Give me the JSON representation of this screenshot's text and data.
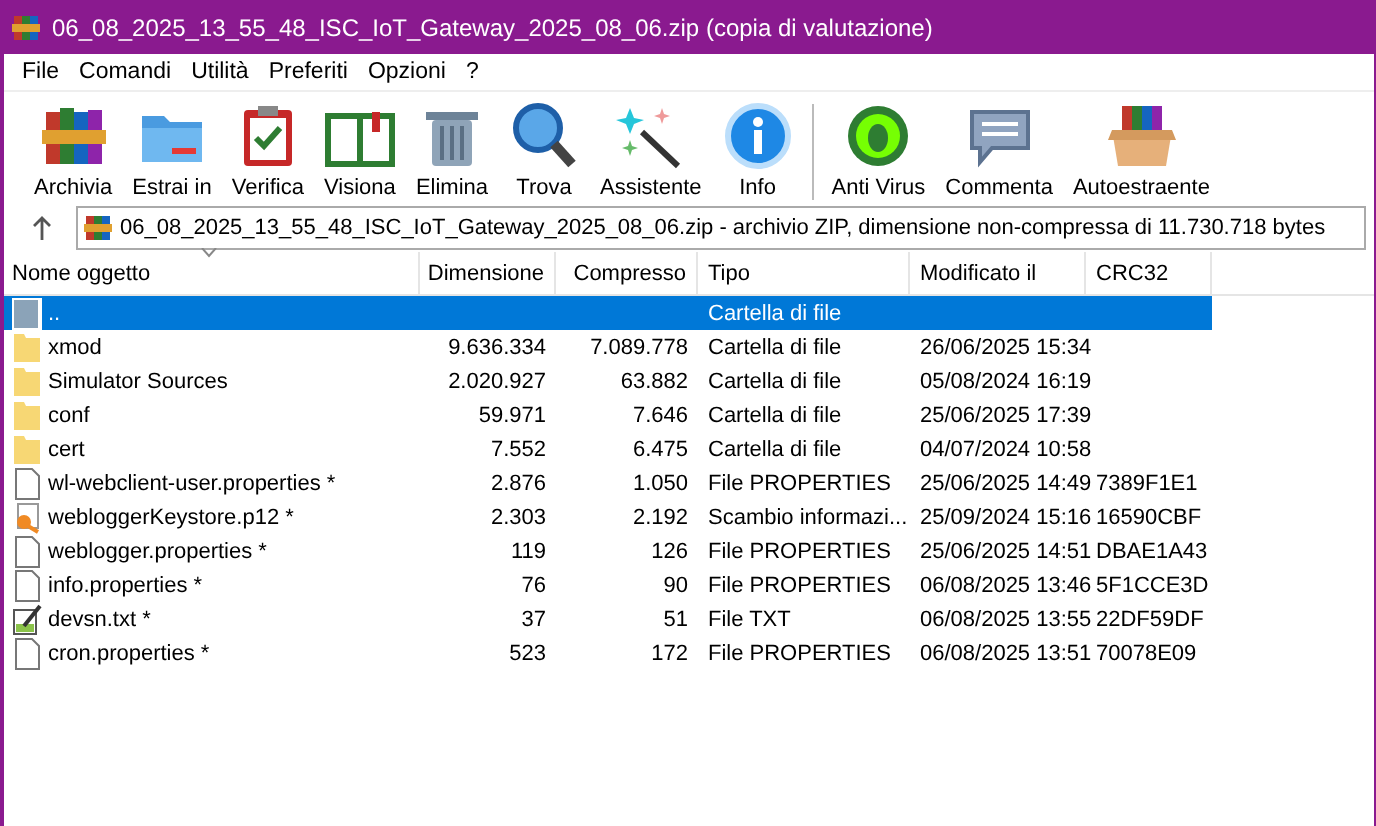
{
  "window": {
    "title": "06_08_2025_13_55_48_ISC_IoT_Gateway_2025_08_06.zip (copia di valutazione)"
  },
  "menu": [
    "File",
    "Comandi",
    "Utilità",
    "Preferiti",
    "Opzioni",
    "?"
  ],
  "toolbar_groups": [
    [
      {
        "label": "Archivia",
        "kind": "archive"
      },
      {
        "label": "Estrai in",
        "kind": "extract"
      },
      {
        "label": "Verifica",
        "kind": "test"
      },
      {
        "label": "Visiona",
        "kind": "view"
      },
      {
        "label": "Elimina",
        "kind": "delete"
      },
      {
        "label": "Trova",
        "kind": "find"
      },
      {
        "label": "Assistente",
        "kind": "wizard"
      },
      {
        "label": "Info",
        "kind": "info"
      }
    ],
    [
      {
        "label": "Anti Virus",
        "kind": "virus"
      },
      {
        "label": "Commenta",
        "kind": "comment"
      },
      {
        "label": "Autoestraente",
        "kind": "sfx"
      }
    ]
  ],
  "address": {
    "text": "06_08_2025_13_55_48_ISC_IoT_Gateway_2025_08_06.zip - archivio ZIP, dimensione non-compressa di 11.730.718 bytes"
  },
  "table": {
    "columns": [
      "Nome oggetto",
      "Dimensione",
      "Compresso",
      "Tipo",
      "Modificato il",
      "CRC32"
    ],
    "rows": [
      {
        "kind": "up",
        "name": "..",
        "type": "Cartella di file",
        "selected": true
      },
      {
        "kind": "folder",
        "name": "xmod",
        "size": "9.636.334",
        "packed": "7.089.778",
        "type": "Cartella di file",
        "modified": "26/06/2025 15:34",
        "selected": false
      },
      {
        "kind": "folder",
        "name": "Simulator Sources",
        "size": "2.020.927",
        "packed": "63.882",
        "type": "Cartella di file",
        "modified": "05/08/2024 16:19",
        "selected": false
      },
      {
        "kind": "folder",
        "name": "conf",
        "size": "59.971",
        "packed": "7.646",
        "type": "Cartella di file",
        "modified": "25/06/2025 17:39",
        "selected": false
      },
      {
        "kind": "folder",
        "name": "cert",
        "size": "7.552",
        "packed": "6.475",
        "type": "Cartella di file",
        "modified": "04/07/2024 10:58",
        "selected": false
      },
      {
        "kind": "file",
        "name": "wl-webclient-user.properties *",
        "size": "2.876",
        "packed": "1.050",
        "type": "File PROPERTIES",
        "modified": "25/06/2025 14:49",
        "crc": "7389F1E1",
        "selected": false
      },
      {
        "kind": "cert",
        "name": "webloggerKeystore.p12 *",
        "size": "2.303",
        "packed": "2.192",
        "type": "Scambio informazi...",
        "modified": "25/09/2024 15:16",
        "crc": "16590CBF",
        "selected": false
      },
      {
        "kind": "file",
        "name": "weblogger.properties *",
        "size": "119",
        "packed": "126",
        "type": "File PROPERTIES",
        "modified": "25/06/2025 14:51",
        "crc": "DBAE1A43",
        "selected": false
      },
      {
        "kind": "file",
        "name": "info.properties *",
        "size": "76",
        "packed": "90",
        "type": "File PROPERTIES",
        "modified": "06/08/2025 13:46",
        "crc": "5F1CCE3D",
        "selected": false
      },
      {
        "kind": "text",
        "name": "devsn.txt *",
        "size": "37",
        "packed": "51",
        "type": "File TXT",
        "modified": "06/08/2025 13:55",
        "crc": "22DF59DF",
        "selected": false
      },
      {
        "kind": "file",
        "name": "cron.properties *",
        "size": "523",
        "packed": "172",
        "type": "File PROPERTIES",
        "modified": "06/08/2025 13:51",
        "crc": "70078E09",
        "selected": false
      }
    ]
  }
}
